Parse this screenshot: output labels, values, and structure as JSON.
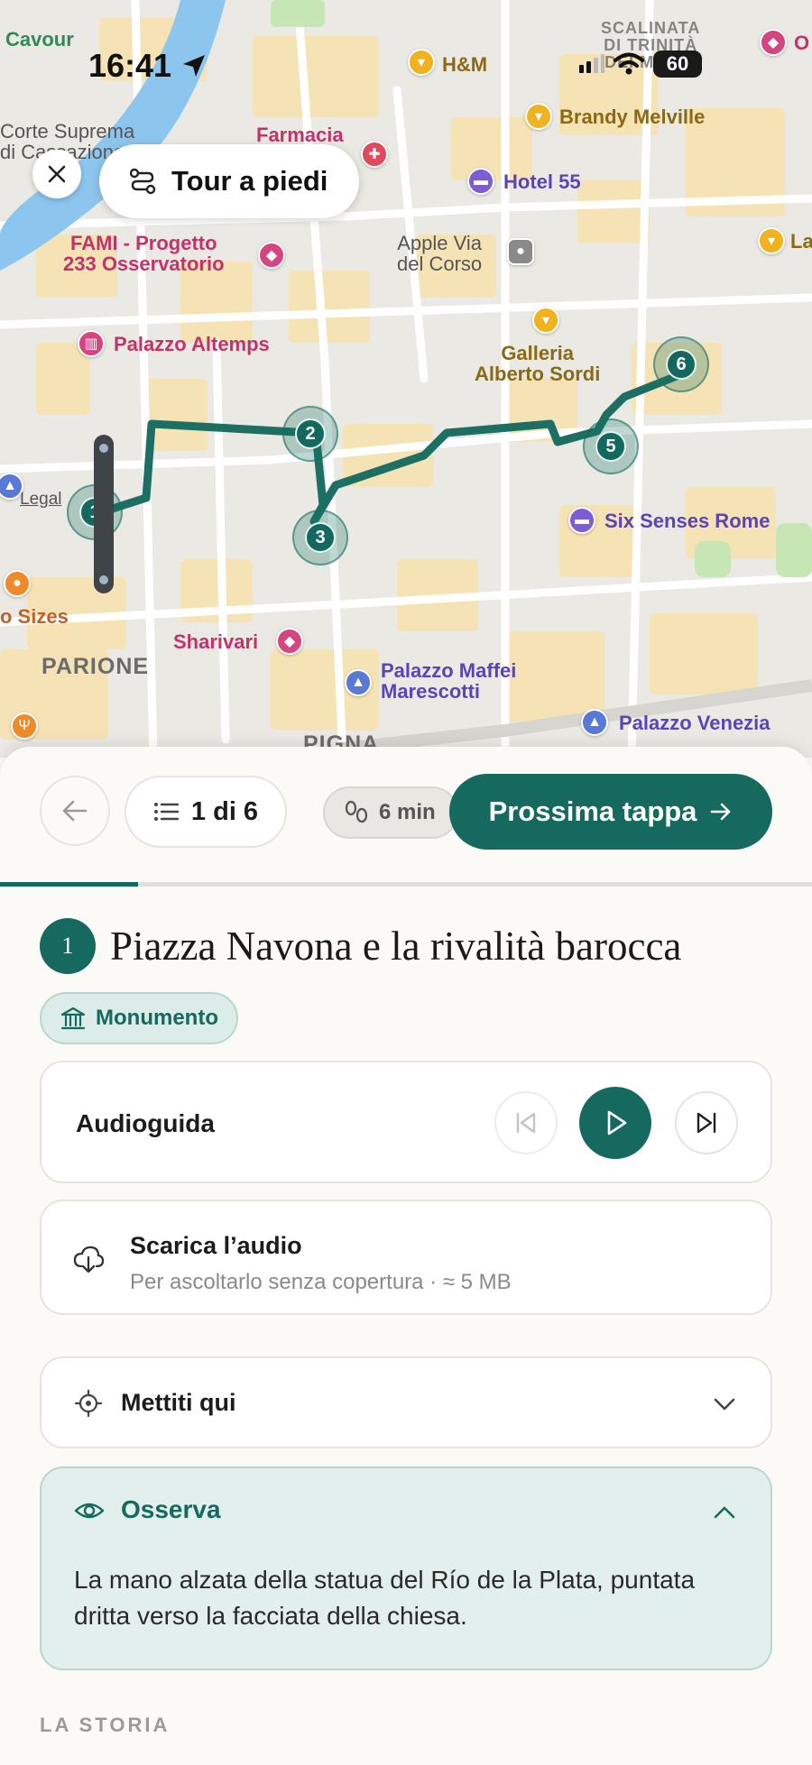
{
  "status_bar": {
    "time": "16:41",
    "battery": "60"
  },
  "map": {
    "close_icon": "close-icon",
    "tour_pill": {
      "label": "Tour a piedi",
      "icon": "route-icon"
    },
    "legal": "Legal",
    "labels": {
      "cavour": "Cavour",
      "corte": "Corte Suprema\ndi Cassazione",
      "farmacia": "Farmacia",
      "hm": "H&M",
      "brandy": "Brandy Melville",
      "scalinata": "SCALINATA\nDI TRINITÀ\nDEI MONTI",
      "hotel55": "Hotel 55",
      "fami": "FAMI - Progetto\n233 Osservatorio",
      "apple": "Apple Via\ndel Corso",
      "altemps": "Palazzo Altemps",
      "galleria": "Galleria\nAlberto Sordi",
      "sixsenses": "Six Senses Rome",
      "sizes": "o Sizes",
      "sharivari": "Sharivari",
      "parione": "PARIONE",
      "maffei": "Palazzo Maffei\nMarescotti",
      "venezia": "Palazzo Venezia",
      "pigna": "PIGNA",
      "o": "O",
      "la": "La"
    },
    "stops": [
      "1",
      "2",
      "3",
      "5",
      "6"
    ]
  },
  "sheet": {
    "counter": "1 di 6",
    "walk_time": "6 min",
    "next_label": "Prossima tappa",
    "progress": 0.17,
    "stop_number": "1",
    "title": "Piazza Navona e la rivalità barocca",
    "tag": "Monumento",
    "audio": {
      "label": "Audioguida"
    },
    "download": {
      "title": "Scarica l’audio",
      "subtitle": "Per ascoltarlo senza copertura · ≈ 5 MB"
    },
    "place": {
      "title": "Mettiti qui"
    },
    "observe": {
      "title": "Osserva",
      "body": "La mano alzata della statua del Río de la Plata, puntata dritta verso la facciata della chiesa."
    },
    "section_label": "LA STORIA"
  },
  "colors": {
    "accent": "#15695e",
    "route": "#1c6f62"
  }
}
